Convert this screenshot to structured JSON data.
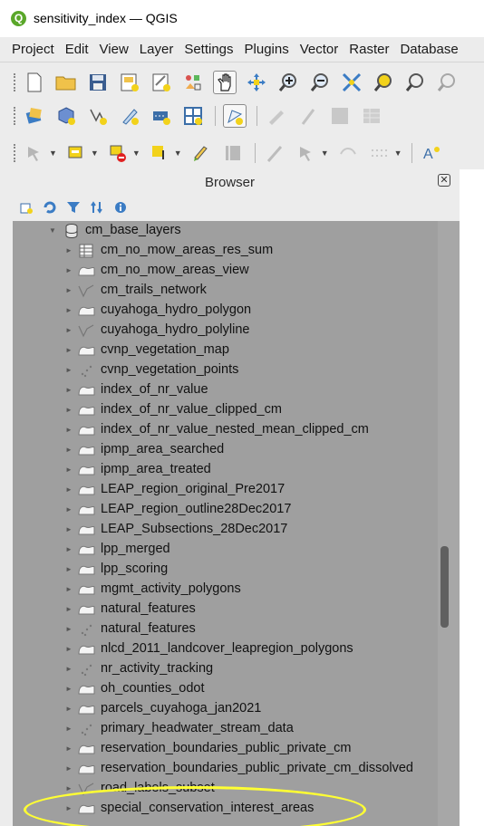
{
  "window": {
    "title": "sensitivity_index — QGIS",
    "app_icon": "qgis-logo-icon"
  },
  "menu": [
    "Project",
    "Edit",
    "View",
    "Layer",
    "Settings",
    "Plugins",
    "Vector",
    "Raster",
    "Database"
  ],
  "browser": {
    "title": "Browser",
    "close_glyph": "✕",
    "root_label": "cm_base_layers",
    "items": [
      {
        "label": "cm_no_mow_areas_res_sum",
        "icon": "table"
      },
      {
        "label": "cm_no_mow_areas_view",
        "icon": "polygon"
      },
      {
        "label": "cm_trails_network",
        "icon": "line"
      },
      {
        "label": "cuyahoga_hydro_polygon",
        "icon": "polygon"
      },
      {
        "label": "cuyahoga_hydro_polyline",
        "icon": "line"
      },
      {
        "label": "cvnp_vegetation_map",
        "icon": "polygon"
      },
      {
        "label": "cvnp_vegetation_points",
        "icon": "point"
      },
      {
        "label": "index_of_nr_value",
        "icon": "polygon"
      },
      {
        "label": "index_of_nr_value_clipped_cm",
        "icon": "polygon"
      },
      {
        "label": "index_of_nr_value_nested_mean_clipped_cm",
        "icon": "polygon"
      },
      {
        "label": "ipmp_area_searched",
        "icon": "polygon"
      },
      {
        "label": "ipmp_area_treated",
        "icon": "polygon"
      },
      {
        "label": "LEAP_region_original_Pre2017",
        "icon": "polygon"
      },
      {
        "label": "LEAP_region_outline28Dec2017",
        "icon": "polygon"
      },
      {
        "label": "LEAP_Subsections_28Dec2017",
        "icon": "polygon"
      },
      {
        "label": "lpp_merged",
        "icon": "polygon"
      },
      {
        "label": "lpp_scoring",
        "icon": "polygon"
      },
      {
        "label": "mgmt_activity_polygons",
        "icon": "polygon"
      },
      {
        "label": "natural_features",
        "icon": "polygon"
      },
      {
        "label": "natural_features",
        "icon": "point"
      },
      {
        "label": "nlcd_2011_landcover_leapregion_polygons",
        "icon": "polygon"
      },
      {
        "label": "nr_activity_tracking",
        "icon": "point"
      },
      {
        "label": "oh_counties_odot",
        "icon": "polygon"
      },
      {
        "label": "parcels_cuyahoga_jan2021",
        "icon": "polygon"
      },
      {
        "label": "primary_headwater_stream_data",
        "icon": "point"
      },
      {
        "label": "reservation_boundaries_public_private_cm",
        "icon": "polygon"
      },
      {
        "label": "reservation_boundaries_public_private_cm_dissolved",
        "icon": "polygon"
      },
      {
        "label": "road_labels_subset",
        "icon": "line"
      },
      {
        "label": "special_conservation_interest_areas",
        "icon": "polygon"
      }
    ]
  },
  "colors": {
    "highlight": "#ffff33",
    "tree_bg": "#9f9f9f",
    "qgis_green": "#5aa72a"
  }
}
